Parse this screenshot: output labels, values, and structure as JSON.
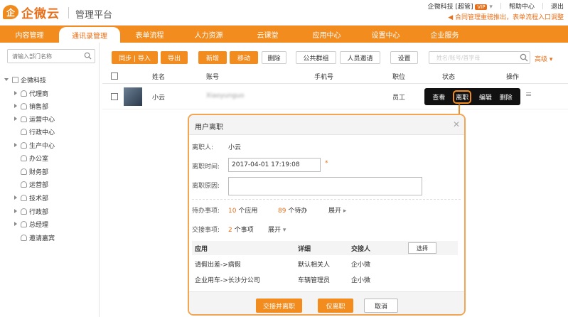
{
  "header": {
    "logo_mark": "企",
    "logo_text": "企微云",
    "platform": "管理平台",
    "company": "企微科技",
    "role": "[超管]",
    "vip": "VIP",
    "help": "帮助中心",
    "logout": "退出",
    "notice": "合同管理重磅推出，表单流程入口调整"
  },
  "nav": {
    "items": [
      "内容管理",
      "通讯录管理",
      "表单流程",
      "人力资源",
      "云课堂",
      "应用中心",
      "设置中心",
      "企业服务"
    ]
  },
  "sidebar": {
    "search_placeholder": "请输入部门名称",
    "root": "企微科技",
    "items": [
      "代理商",
      "销售部",
      "运营中心",
      "行政中心",
      "生产中心",
      "办公室",
      "财务部",
      "运营部",
      "技术部",
      "行政部",
      "总经理",
      "邀请嘉宾"
    ]
  },
  "toolbar": {
    "sync": "同步 | 导入",
    "export": "导出",
    "add": "新增",
    "move": "移动",
    "delete": "删除",
    "public_group": "公共群组",
    "invite": "人员邀请",
    "settings": "设置",
    "search_placeholder": "姓名/账号/首字母",
    "advanced": "高级"
  },
  "table": {
    "headers": {
      "name": "姓名",
      "account": "账号",
      "phone": "手机号",
      "position": "职位",
      "status": "状态",
      "action": "操作"
    },
    "rows": [
      {
        "name": "小云",
        "account": "Xiaoyunguo",
        "position": "员工"
      }
    ]
  },
  "context_menu": {
    "view": "查看",
    "resign": "离职",
    "edit": "编辑",
    "delete": "删除"
  },
  "dialog": {
    "title": "用户离职",
    "resigner_label": "离职人:",
    "resigner_value": "小云",
    "time_label": "离职时间:",
    "time_value": "2017-04-01 17:19:08",
    "required": "*",
    "reason_label": "离职原因:",
    "todo_label": "待办事项:",
    "todo_apps_num": "10",
    "todo_apps_text": "个应用",
    "todo_pending_num": "89",
    "todo_pending_text": "个待办",
    "expand": "展开",
    "handover_label": "交接事项:",
    "handover_num": "2",
    "handover_text": "个事项",
    "handover_head": {
      "app": "应用",
      "detail": "详细",
      "receiver": "交接人",
      "select": "选择"
    },
    "handover_rows": [
      {
        "app": "请假出差->病假",
        "detail": "默认相关人",
        "receiver": "企小微"
      },
      {
        "app": "企业用车->长沙分公司",
        "detail": "车辆管理员",
        "receiver": "企小微"
      }
    ],
    "btn_handover_resign": "交接并离职",
    "btn_resign_only": "仅离职",
    "btn_cancel": "取消"
  },
  "colors": {
    "accent": "#f28c1e",
    "brand_text": "#e8701a"
  }
}
